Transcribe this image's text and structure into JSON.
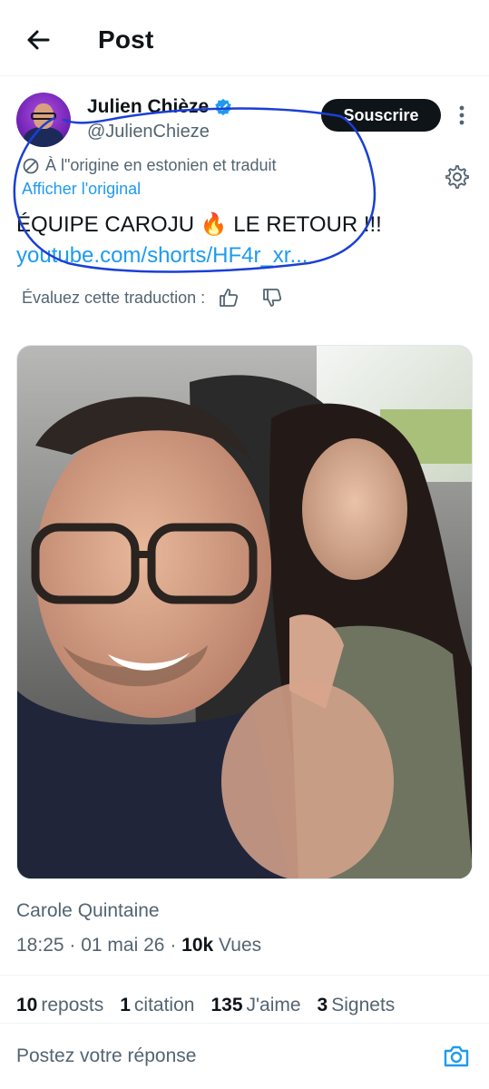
{
  "header": {
    "title": "Post",
    "back_icon": "arrow-left-icon"
  },
  "author": {
    "name": "Julien Chièze",
    "handle": "@JulienChieze",
    "verified": true,
    "subscribe_label": "Souscrire"
  },
  "translation": {
    "note": "À l\"origine en estonien et traduit",
    "show_original": "Afficher l'original",
    "rate_label": "Évaluez cette traduction :"
  },
  "post": {
    "text": "ÉQUIPE CAROJU 🔥 LE RETOUR !!!",
    "link": "youtube.com/shorts/HF4r_xr..."
  },
  "media": {
    "credit": "Carole Quintaine"
  },
  "meta": {
    "time": "18:25",
    "date": "01 mai 26",
    "views_count": "10k",
    "views_label": "Vues"
  },
  "stats": [
    {
      "count": "10",
      "label": "reposts"
    },
    {
      "count": "1",
      "label": "citation"
    },
    {
      "count": "135",
      "label": "J'aime"
    },
    {
      "count": "3",
      "label": "Signets"
    }
  ],
  "reply": {
    "placeholder": "Postez votre réponse"
  },
  "colors": {
    "accent": "#1d9bf0",
    "text": "#0f1419",
    "muted": "#536471",
    "annotation": "#1a3fd6"
  }
}
